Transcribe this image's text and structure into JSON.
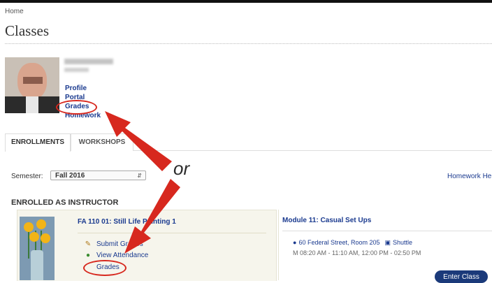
{
  "breadcrumb": "Home",
  "page_title": "Classes",
  "profile_links": [
    "Profile",
    "Portal",
    "Grades",
    "Homework"
  ],
  "tabs": [
    {
      "label": "ENROLLMENTS",
      "active": true
    },
    {
      "label": "WORKSHOPS",
      "active": false
    }
  ],
  "semester": {
    "label": "Semester:",
    "value": "Fall 2016"
  },
  "homework_help": "Homework Help",
  "section_heading": "ENROLLED AS INSTRUCTOR",
  "class": {
    "title": "FA 110 01: Still Life Painting 1",
    "actions": [
      "Submit Grades",
      "View Attendance",
      "Grades"
    ]
  },
  "module": {
    "title": "Module 11: Casual Set Ups",
    "location": "60 Federal Street, Room 205",
    "shuttle": "Shuttle",
    "schedule": "M 08:20 AM - 11:10 AM, 12:00 PM - 02:50 PM",
    "enter_button": "Enter Class"
  },
  "annotation": {
    "or_text": "or",
    "color": "#d7281e"
  },
  "icons": {
    "location": "map-pin-icon",
    "shuttle": "bus-icon",
    "submit": "edit-icon",
    "attendance": "people-icon"
  }
}
